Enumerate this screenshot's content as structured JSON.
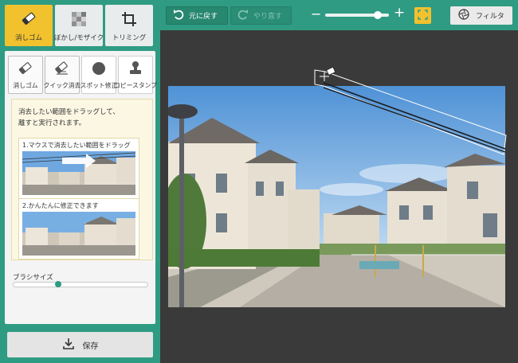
{
  "tools": [
    {
      "label": "消しゴム",
      "icon": "eraser-icon"
    },
    {
      "label": "ぼかし/モザイク",
      "icon": "mosaic-icon"
    },
    {
      "label": "トリミング",
      "icon": "crop-icon"
    }
  ],
  "sub_tools": [
    {
      "label": "消しゴム",
      "icon": "eraser-brush-icon"
    },
    {
      "label": "クイック消去",
      "icon": "quick-erase-icon"
    },
    {
      "label": "スポット修正",
      "icon": "spot-fix-icon"
    },
    {
      "label": "コピースタンプ",
      "icon": "copy-stamp-icon"
    }
  ],
  "help": {
    "intro_line1": "消去したい範囲をドラッグして、",
    "intro_line2": "離すと実行されます。",
    "step1": "1.マウスで消去したい範囲をドラッグ",
    "step2": "2.かんたんに修正できます"
  },
  "brush": {
    "label": "ブラシサイズ",
    "value_fraction": 0.33
  },
  "save": {
    "label": "保存",
    "icon": "download-icon"
  },
  "toolbar": {
    "undo_label": "元に戻す",
    "redo_label": "やり直す",
    "zoom_fraction": 0.82,
    "filter_label": "フィルタ"
  },
  "colors": {
    "accent": "#2f9b83",
    "active_tool": "#f2c12e",
    "canvas_bg": "#3a3a3a"
  }
}
